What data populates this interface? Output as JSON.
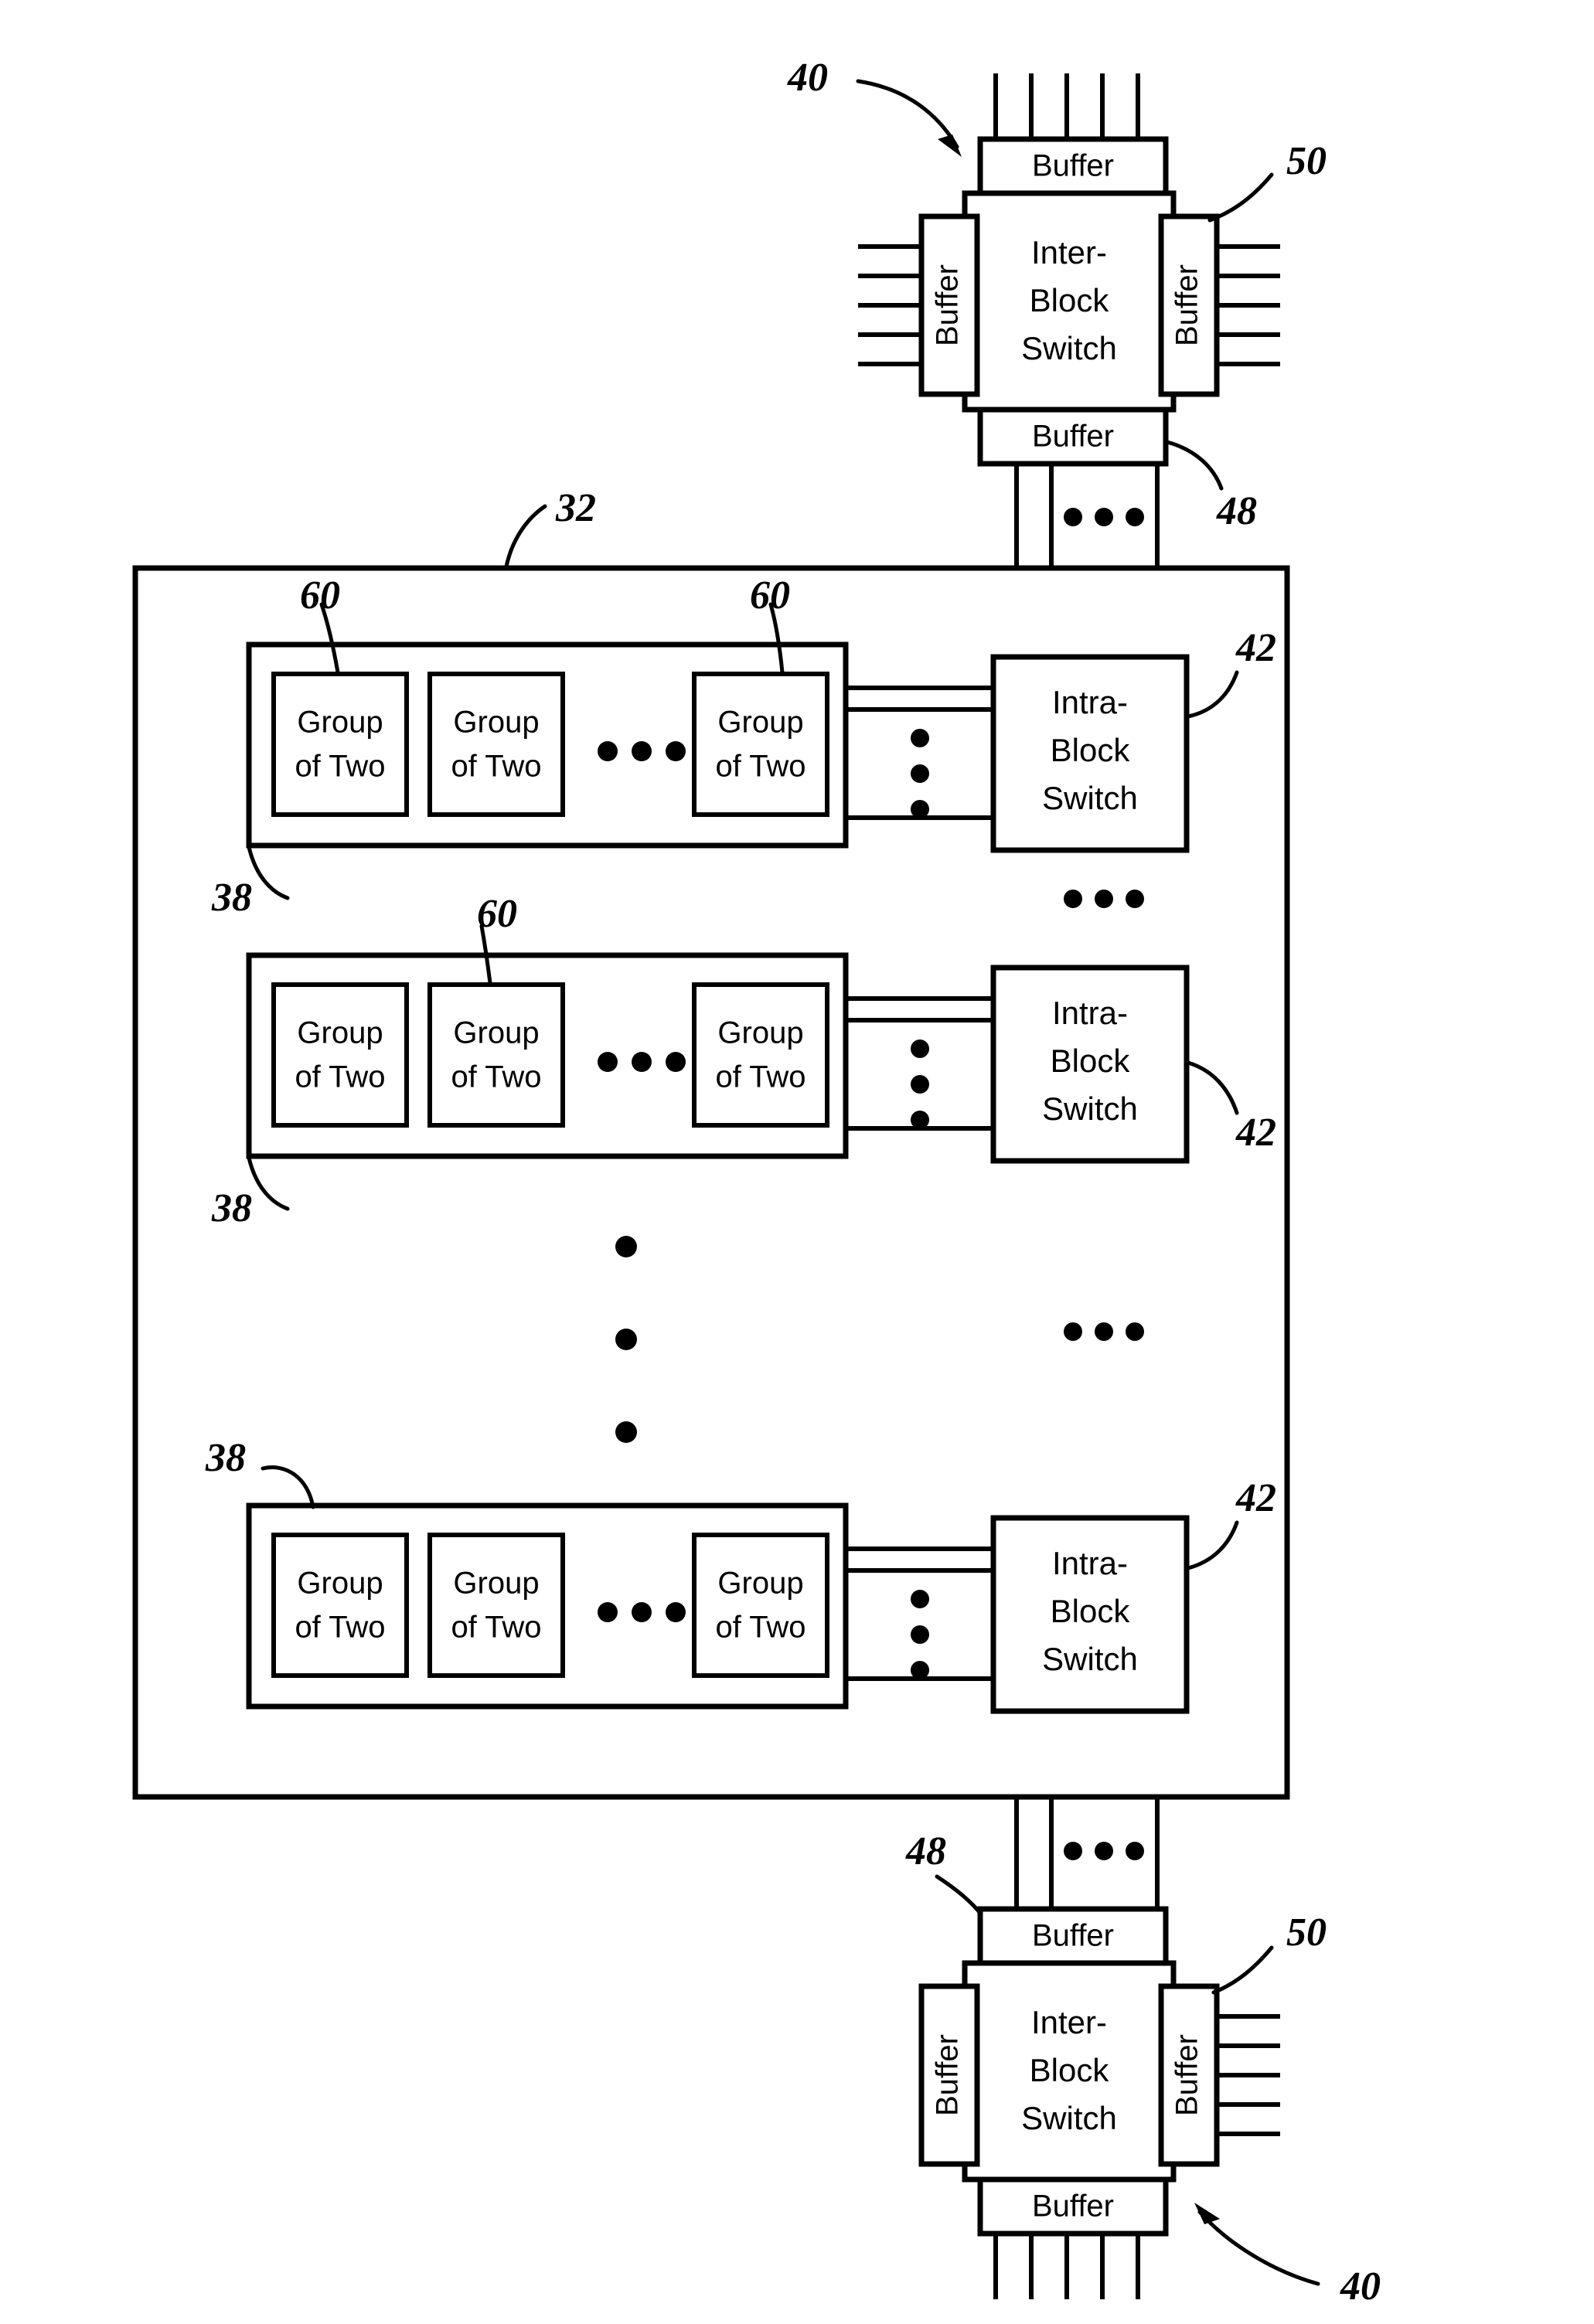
{
  "figure": {
    "title": "Hierarchical switch fabric block diagram",
    "line_color": "#000000",
    "background_color": "#ffffff"
  },
  "labels": {
    "buffer": "Buffer",
    "inter_block_switch": "Inter-\nBlock\nSwitch",
    "inter_block_switch_l1": "Inter-",
    "inter_block_switch_l2": "Block",
    "inter_block_switch_l3": "Switch",
    "intra_block_switch_l1": "Intra-",
    "intra_block_switch_l2": "Block",
    "intra_block_switch_l3": "Switch",
    "group_of_two_l1": "Group",
    "group_of_two_l2": "of Two"
  },
  "reference_numerals": {
    "outer_block": "32",
    "group_row": "38",
    "inter_block_switch": "40",
    "intra_block_switch": "42",
    "bus_link": "48",
    "side_buffer": "50",
    "group_of_two": "60"
  },
  "top_switch": {
    "name": "inter-block-switch-top",
    "ref": "40",
    "top_buffer": {
      "label": "Buffer",
      "ref": "48",
      "port_count": 5
    },
    "left_buffer": {
      "label": "Buffer",
      "ref": "50",
      "port_count": 5
    },
    "right_buffer": {
      "label": "Buffer",
      "ref": "50",
      "port_count": 5
    },
    "bottom_buffer": {
      "label": "Buffer",
      "ref": "48",
      "port_count": 3
    },
    "switch_label": "Inter-Block Switch"
  },
  "bottom_switch": {
    "name": "inter-block-switch-bottom",
    "ref": "40",
    "top_buffer": {
      "label": "Buffer",
      "ref": "48",
      "port_count": 3
    },
    "left_buffer": {
      "label": "Buffer",
      "ref": "50",
      "port_count": 0
    },
    "right_buffer": {
      "label": "Buffer",
      "ref": "50",
      "port_count": 5
    },
    "bottom_buffer": {
      "label": "Buffer",
      "ref": "48",
      "port_count": 5
    },
    "switch_label": "Inter-Block Switch"
  },
  "outer_block": {
    "name": "block-32",
    "ref": "32",
    "rows": [
      {
        "ref": "38",
        "ref_position": "bottom-left",
        "groups": [
          {
            "ref": "60",
            "label_l1": "Group",
            "label_l2": "of Two",
            "leader": true
          },
          {
            "ref": null,
            "label_l1": "Group",
            "label_l2": "of Two",
            "leader": false
          },
          {
            "ref": "60",
            "label_l1": "Group",
            "label_l2": "of Two",
            "leader": true
          }
        ],
        "ellipsis": "• • •",
        "switch": {
          "ref": "42",
          "label_l1": "Intra-",
          "label_l2": "Block",
          "label_l3": "Switch",
          "ref_position": "top-right"
        }
      },
      {
        "ref": "38",
        "ref_position": "bottom-left",
        "groups": [
          {
            "ref": null,
            "label_l1": "Group",
            "label_l2": "of Two",
            "leader": false
          },
          {
            "ref": "60",
            "label_l1": "Group",
            "label_l2": "of Two",
            "leader": true
          },
          {
            "ref": null,
            "label_l1": "Group",
            "label_l2": "of Two",
            "leader": false
          }
        ],
        "ellipsis": "• • •",
        "switch": {
          "ref": "42",
          "label_l1": "Intra-",
          "label_l2": "Block",
          "label_l3": "Switch",
          "ref_position": "bottom-right"
        }
      },
      {
        "ref": "38",
        "ref_position": "top-left",
        "groups": [
          {
            "ref": null,
            "label_l1": "Group",
            "label_l2": "of Two",
            "leader": false
          },
          {
            "ref": null,
            "label_l1": "Group",
            "label_l2": "of Two",
            "leader": false
          },
          {
            "ref": null,
            "label_l1": "Group",
            "label_l2": "of Two",
            "leader": false
          }
        ],
        "ellipsis": "• • •",
        "switch": {
          "ref": "42",
          "label_l1": "Intra-",
          "label_l2": "Block",
          "label_l3": "Switch",
          "ref_position": "top-right"
        }
      }
    ],
    "vertical_ellipsis": "⋮"
  },
  "bus": {
    "line_count": 3,
    "horizontal_ellipsis_count": 3
  }
}
